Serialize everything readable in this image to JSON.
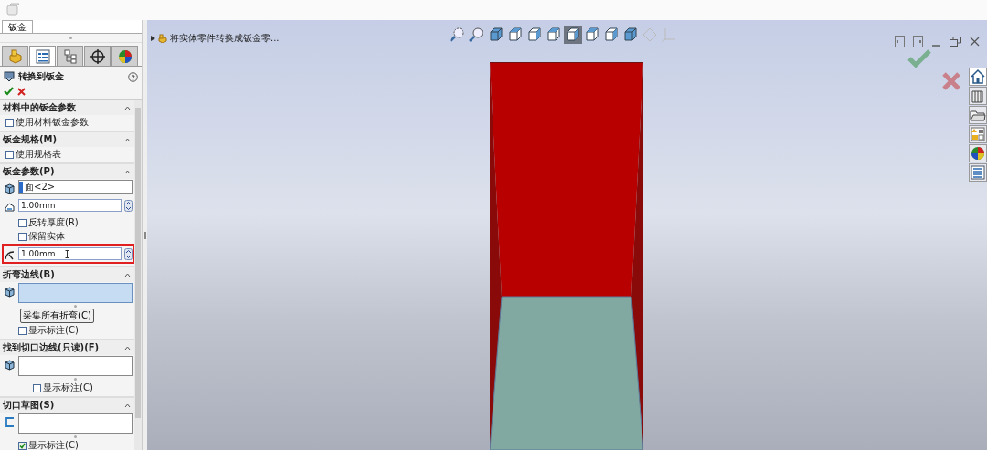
{
  "document_tab": {
    "label": "钣金"
  },
  "panel_tabs": [
    {
      "selected": false
    },
    {
      "selected": true
    },
    {
      "selected": false
    },
    {
      "selected": false
    },
    {
      "selected": false
    }
  ],
  "feature": {
    "title": "转换到钣金"
  },
  "sections": [
    {
      "title": "材料中的钣金参数",
      "items": [
        {
          "kind": "checkbox",
          "label": "使用材料钣金参数",
          "checked": false
        }
      ]
    },
    {
      "title": "钣金规格(M)",
      "items": [
        {
          "kind": "checkbox",
          "label": "使用规格表",
          "checked": false
        }
      ]
    },
    {
      "title": "钣金参数(P)",
      "items": [
        {
          "kind": "selection",
          "value": "面<2>",
          "active": false
        },
        {
          "kind": "number",
          "value": "1.00mm",
          "highlighted": false
        },
        {
          "kind": "checkbox",
          "label": "反转厚度(R)",
          "checked": false
        },
        {
          "kind": "checkbox",
          "label": "保留实体",
          "checked": false
        },
        {
          "kind": "number",
          "value": "1.00mm",
          "highlighted": true
        }
      ]
    },
    {
      "title": "折弯边线(B)",
      "items": [
        {
          "kind": "selection",
          "active": true
        },
        {
          "kind": "button",
          "label": "采集所有折弯(C)"
        },
        {
          "kind": "checkbox",
          "label": "显示标注(C)",
          "checked": false
        }
      ]
    },
    {
      "title": "找到切口边线(只读)(F)",
      "items": [
        {
          "kind": "selection",
          "active": false
        },
        {
          "kind": "checkbox",
          "label": "显示标注(C)",
          "checked": false
        }
      ]
    },
    {
      "title": "切口草图(S)",
      "items": [
        {
          "kind": "selection",
          "active": false
        },
        {
          "kind": "checkbox",
          "label": "显示标注(C)",
          "checked": true
        }
      ]
    }
  ],
  "breadcrumb": {
    "label": "将实体零件转换成钣金零..."
  },
  "view_toolbar": [
    {
      "selected": false
    },
    {
      "selected": false
    },
    {
      "selected": false
    },
    {
      "selected": false
    },
    {
      "selected": false
    },
    {
      "selected": false
    },
    {
      "selected": true
    },
    {
      "selected": false
    },
    {
      "selected": false
    },
    {
      "selected": false
    },
    {
      "selected": false
    },
    {
      "selected": false
    }
  ],
  "task_pane": [
    {
      "selected": true
    },
    {
      "selected": false
    },
    {
      "selected": false
    },
    {
      "selected": false
    },
    {
      "selected": false
    },
    {
      "selected": false
    }
  ]
}
